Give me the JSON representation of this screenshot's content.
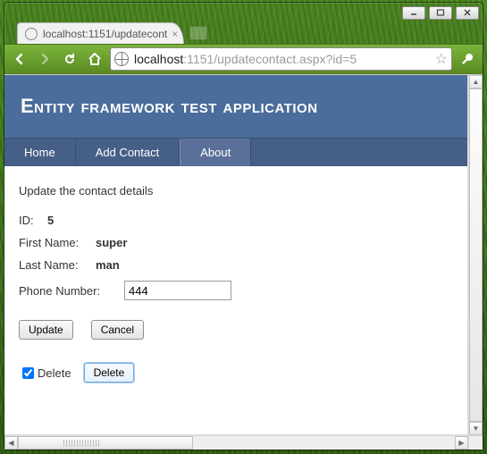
{
  "window": {
    "tab_title": "localhost:1151/updatecont",
    "url_host": "localhost",
    "url_rest": ":1151/updatecontact.aspx?id=5"
  },
  "header": {
    "title": "Entity framework test application"
  },
  "nav": {
    "items": [
      {
        "label": "Home"
      },
      {
        "label": "Add Contact"
      },
      {
        "label": "About"
      }
    ]
  },
  "form": {
    "lead": "Update the contact details",
    "id_label": "ID:",
    "id_value": "5",
    "first_name_label": "First Name:",
    "first_name_value": "super",
    "last_name_label": "Last Name:",
    "last_name_value": "man",
    "phone_label": "Phone Number:",
    "phone_value": "444",
    "update_btn": "Update",
    "cancel_btn": "Cancel",
    "delete_chk_label": "Delete",
    "delete_chk_checked": true,
    "delete_btn": "Delete"
  }
}
